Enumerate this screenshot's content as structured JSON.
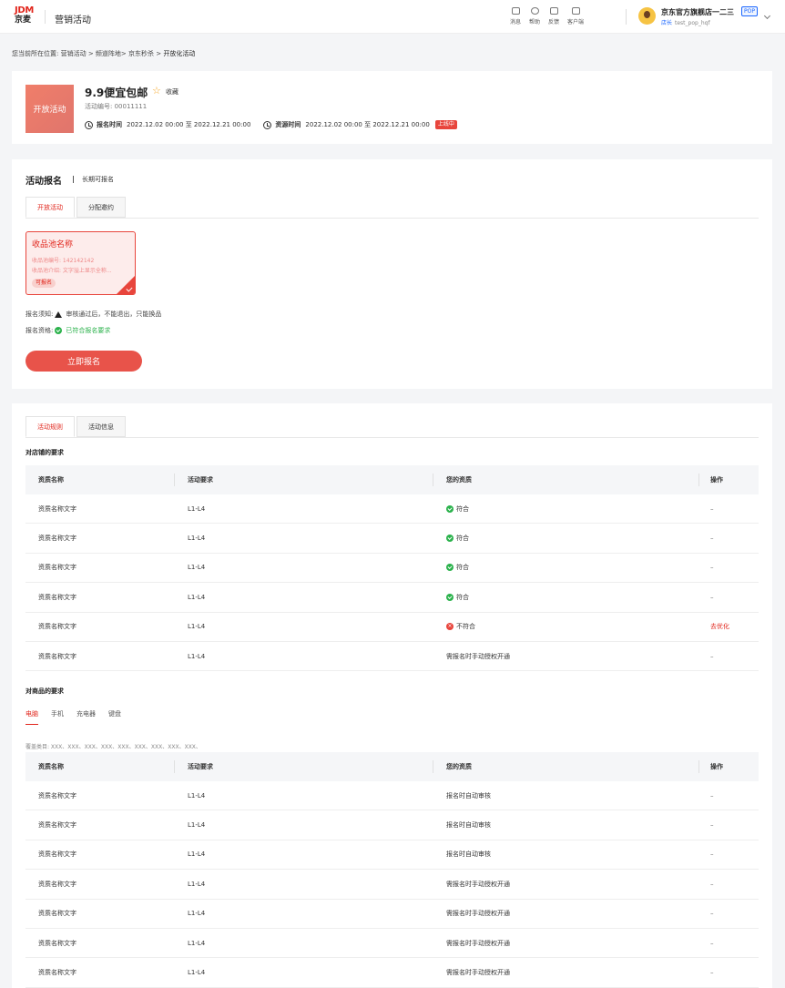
{
  "topbar": {
    "logo_top": "JDM",
    "logo_bottom": "京麦",
    "app_title": "营销活动",
    "tools": [
      {
        "icon": "message-icon",
        "label": "消息"
      },
      {
        "icon": "help-icon",
        "label": "帮助"
      },
      {
        "icon": "feedback-icon",
        "label": "反馈"
      },
      {
        "icon": "client-icon",
        "label": "客户端"
      }
    ],
    "user": {
      "shop_name": "京东官方旗舰店一二三",
      "badge": "POP",
      "role": "店长",
      "account": "test_pop_hqf"
    }
  },
  "breadcrumb": {
    "prefix": "您当前所在位置:",
    "path": "营销活动 > 频道阵地> 京东秒杀 >",
    "current": "开放化活动"
  },
  "activity": {
    "thumb_label": "开放活动",
    "name": "9.9便宜包邮",
    "fav_label": "收藏",
    "number": "活动编号: 00011111",
    "signup_time_label": "报名时间",
    "signup_time": "2022.12.02 00:00 至 2022.12.21 00:00",
    "resource_time_label": "资源时间",
    "resource_time": "2022.12.02 00:00 至 2022.12.21 00:00",
    "status": "上线中"
  },
  "signup": {
    "title": "活动报名",
    "subtitle": "长期可报名",
    "tabs": [
      "开放活动",
      "分配邀约"
    ],
    "pool": {
      "name": "收品池名称",
      "number": "收品池编号: 142142142",
      "intro": "收品池介绍: 文字溢上显示全称...",
      "badge": "可报名"
    },
    "notice_label": "报名须知:",
    "notice": "审核通过后，不能退出，只能换品",
    "qualification_label": "报名资格:",
    "qualification": "已符合报名要求",
    "button": "立即报名"
  },
  "rules": {
    "tabs": [
      "活动规则",
      "活动信息"
    ],
    "shop_heading": "对店铺的要求",
    "columns": [
      "资质名称",
      "活动要求",
      "您的资质",
      "操作"
    ],
    "shop_rows": [
      {
        "name": "资质名称文字",
        "req": "L1-L4",
        "status": "符合",
        "kind": "ok",
        "action": "–"
      },
      {
        "name": "资质名称文字",
        "req": "L1-L4",
        "status": "符合",
        "kind": "ok",
        "action": "–"
      },
      {
        "name": "资质名称文字",
        "req": "L1-L4",
        "status": "符合",
        "kind": "ok",
        "action": "–"
      },
      {
        "name": "资质名称文字",
        "req": "L1-L4",
        "status": "符合",
        "kind": "ok",
        "action": "–"
      },
      {
        "name": "资质名称文字",
        "req": "L1-L4",
        "status": "不符合",
        "kind": "bad",
        "action": "去优化"
      },
      {
        "name": "资质名称文字",
        "req": "L1-L4",
        "status": "需报名时手动授权开通",
        "kind": "text",
        "action": "–"
      }
    ],
    "product_heading": "对商品的要求",
    "categories": [
      "电脑",
      "手机",
      "充电器",
      "键盘"
    ],
    "coverage": "覆盖类目: XXX、XXX、XXX、XXX、XXX、XXX、XXX、XXX、XXX、",
    "product_rows": [
      {
        "name": "资质名称文字",
        "req": "L1-L4",
        "status": "报名时自动审核",
        "action": "–"
      },
      {
        "name": "资质名称文字",
        "req": "L1-L4",
        "status": "报名时自动审核",
        "action": "–"
      },
      {
        "name": "资质名称文字",
        "req": "L1-L4",
        "status": "报名时自动审核",
        "action": "–"
      },
      {
        "name": "资质名称文字",
        "req": "L1-L4",
        "status": "需报名时手动授权开通",
        "action": "–"
      },
      {
        "name": "资质名称文字",
        "req": "L1-L4",
        "status": "需报名时手动授权开通",
        "action": "–"
      },
      {
        "name": "资质名称文字",
        "req": "L1-L4",
        "status": "需报名时手动授权开通",
        "action": "–"
      },
      {
        "name": "资质名称文字",
        "req": "L1-L4",
        "status": "需报名时手动授权开通",
        "action": "–"
      }
    ]
  }
}
